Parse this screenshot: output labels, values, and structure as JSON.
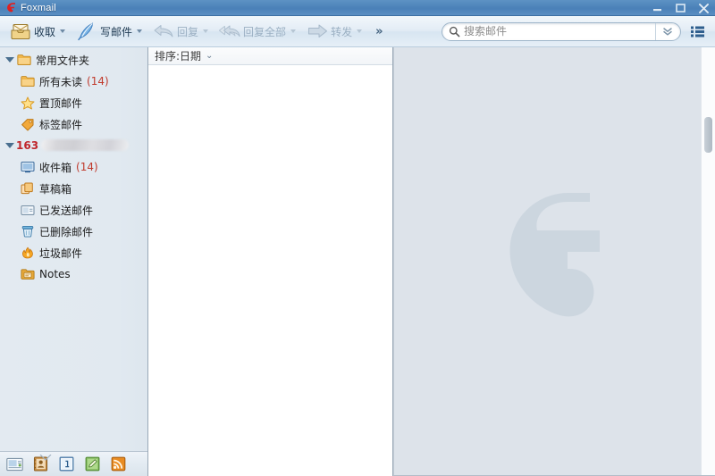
{
  "window": {
    "title": "Foxmail",
    "logo_icon": "foxmail-logo-icon",
    "controls": [
      {
        "name": "minimize",
        "icon": "minimize-icon"
      },
      {
        "name": "maximize",
        "icon": "maximize-icon"
      },
      {
        "name": "close",
        "icon": "close-icon"
      }
    ]
  },
  "toolbar": {
    "buttons": [
      {
        "label": "收取",
        "icon": "receive-mail-icon",
        "has_dropdown": true,
        "disabled": false
      },
      {
        "label": "写邮件",
        "icon": "compose-mail-icon",
        "has_dropdown": true,
        "disabled": false
      },
      {
        "label": "回复",
        "icon": "reply-icon",
        "has_dropdown": true,
        "disabled": true
      },
      {
        "label": "回复全部",
        "icon": "reply-all-icon",
        "has_dropdown": true,
        "disabled": true
      },
      {
        "label": "转发",
        "icon": "forward-icon",
        "has_dropdown": true,
        "disabled": true
      }
    ],
    "overflow_label": "»",
    "search": {
      "placeholder": "搜索邮件",
      "value": "",
      "icon": "search-icon",
      "dropdown_icon": "chevron-double-down-icon"
    },
    "listview_icon": "list-view-icon"
  },
  "sidebar": {
    "groups": [
      {
        "name": "常用文件夹",
        "icon": "folder-icon",
        "expanded": true,
        "type": "group",
        "items": [
          {
            "label": "所有未读",
            "icon": "folder-icon",
            "count": "(14)"
          },
          {
            "label": "置顶邮件",
            "icon": "star-icon",
            "count": ""
          },
          {
            "label": "标签邮件",
            "icon": "tag-icon",
            "count": ""
          }
        ]
      },
      {
        "name": "",
        "account_prefix": "163",
        "account_redacted": true,
        "expanded": true,
        "type": "account",
        "items": [
          {
            "label": "收件箱",
            "icon": "inbox-icon",
            "count": "(14)"
          },
          {
            "label": "草稿箱",
            "icon": "drafts-icon",
            "count": ""
          },
          {
            "label": "已发送邮件",
            "icon": "sent-icon",
            "count": ""
          },
          {
            "label": "已删除邮件",
            "icon": "trash-icon",
            "count": ""
          },
          {
            "label": "垃圾邮件",
            "icon": "junk-icon",
            "count": ""
          },
          {
            "label": "Notes",
            "icon": "notes-icon",
            "count": ""
          }
        ]
      }
    ],
    "bottom_bar": {
      "collapse_icon": "collapse-chevron-icon",
      "buttons": [
        {
          "name": "mail",
          "icon": "mail-module-icon"
        },
        {
          "name": "contacts",
          "icon": "contacts-module-icon"
        },
        {
          "name": "info",
          "icon": "info-module-icon"
        },
        {
          "name": "notes",
          "icon": "notes-module-icon"
        },
        {
          "name": "rss",
          "icon": "rss-module-icon"
        }
      ]
    }
  },
  "message_list": {
    "sort_label": "排序:日期",
    "sort_chevron": "⌄",
    "messages": []
  },
  "preview": {
    "watermark_letter": "G",
    "empty": true
  },
  "colors": {
    "titlebar": "#4e84ba",
    "accent_red": "#c0392b",
    "account_red": "#c0272d",
    "sidebar_bg": "#e2eaf1",
    "preview_bg": "#dde3ea",
    "watermark": "#cdd6df"
  }
}
